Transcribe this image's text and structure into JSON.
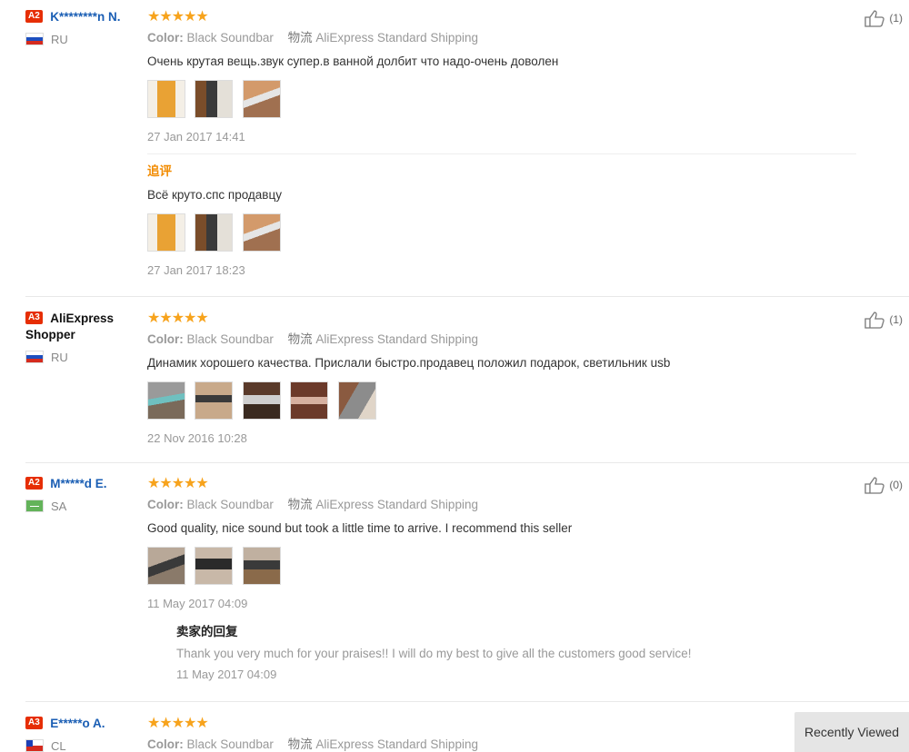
{
  "reviews": [
    {
      "badge": "A2",
      "name": "K********n N.",
      "name_dark": false,
      "country": "RU",
      "flag": "ru",
      "stars": "★★★★★",
      "color_label": "Color:",
      "color_value": "Black Soundbar",
      "ship_label": "物流",
      "ship_value": "AliExpress Standard Shipping",
      "text": "Очень крутая вещь.звук супер.в ванной долбит что надо-очень доволен",
      "images": 3,
      "date": "27 Jan 2017 14:41",
      "likes": "(1)",
      "append": {
        "title": "追评",
        "text": "Всё круто.спс продавцу",
        "images": 3,
        "date": "27 Jan 2017 18:23"
      }
    },
    {
      "badge": "A3",
      "name": "AliExpress Shopper",
      "name_dark": true,
      "country": "RU",
      "flag": "ru",
      "stars": "★★★★★",
      "color_label": "Color:",
      "color_value": "Black Soundbar",
      "ship_label": "物流",
      "ship_value": "AliExpress Standard Shipping",
      "text": "Динамик хорошего качества. Прислали быстро.продавец положил подарок, светильник usb",
      "images": 5,
      "date": "22 Nov 2016 10:28",
      "likes": "(1)"
    },
    {
      "badge": "A2",
      "name": "M*****d E.",
      "name_dark": false,
      "country": "SA",
      "flag": "sa",
      "stars": "★★★★★",
      "color_label": "Color:",
      "color_value": "Black Soundbar",
      "ship_label": "物流",
      "ship_value": "AliExpress Standard Shipping",
      "text": "Good quality, nice sound but took a little time to arrive. I recommend this seller",
      "images": 3,
      "date": "11 May 2017 04:09",
      "likes": "(0)",
      "reply": {
        "title": "卖家的回复",
        "text": "Thank you very much for your praises!! I will do my best to give all the customers good service!",
        "date": "11 May 2017 04:09"
      }
    },
    {
      "badge": "A3",
      "name": "E*****o A.",
      "name_dark": false,
      "country": "CL",
      "flag": "cl",
      "stars": "★★★★★",
      "color_label": "Color:",
      "color_value": "Black Soundbar",
      "ship_label": "物流",
      "ship_value": "AliExpress Standard Shipping"
    }
  ],
  "recently_viewed": "Recently Viewed",
  "colors": {
    "star": "#f7a31c",
    "badge": "#e62e04",
    "name": "#1a5eb4",
    "append": "#f28b00"
  }
}
